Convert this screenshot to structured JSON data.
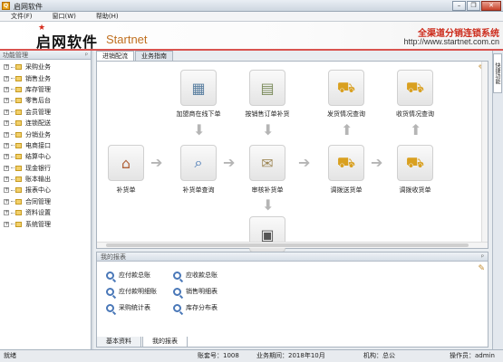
{
  "window": {
    "title": "启网软件",
    "app_icon": "app-logo-icon"
  },
  "menu": [
    "文件(F)",
    "窗口(W)",
    "帮助(H)"
  ],
  "header": {
    "logo_cn": "启网软件",
    "logo_en": "Startnet",
    "slogan": "全渠道分销连锁系统",
    "site": "http://www.startnet.com.cn"
  },
  "sidebar": {
    "title": "功能管理",
    "items": [
      "采购业务",
      "销售业务",
      "库存管理",
      "零售后台",
      "会员管理",
      "连锁配送",
      "分销业务",
      "电商接口",
      "结算中心",
      "现金银行",
      "账本输出",
      "报表中心",
      "合同管理",
      "资料设置",
      "系统管理"
    ]
  },
  "tabs": [
    "进销配流",
    "业务指南"
  ],
  "flow": {
    "nodes": [
      "补货单",
      "补货单查询",
      "加盟商在线下单",
      "按销售订单补货",
      "审核补货单",
      "调拨送货单",
      "发货情况查询",
      "调拨收货单",
      "收货情况查询"
    ]
  },
  "reports": {
    "title": "我的报表",
    "items": [
      "应付款总账",
      "应收款总账",
      "应付款明细账",
      "销售明细表",
      "采购统计表",
      "库存分布表"
    ]
  },
  "bottom_tabs": [
    "基本资料",
    "我的报表"
  ],
  "right_tab": "快捷功能",
  "status": {
    "state": "就绪",
    "account_no": "账套号：1008",
    "period": "业务期间：2018年10月",
    "org": "机构：总公",
    "operator": "操作员：admin"
  }
}
